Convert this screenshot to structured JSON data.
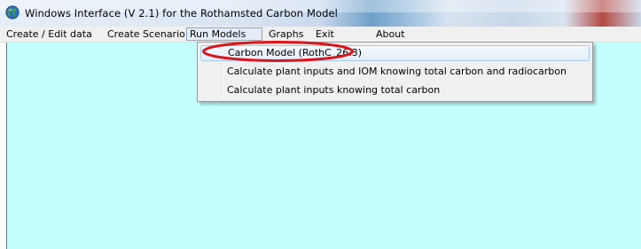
{
  "window": {
    "title": "Windows Interface (V 2.1)  for the Rothamsted Carbon Model",
    "icon": "globe-icon"
  },
  "menubar": {
    "items": [
      {
        "label": "Create / Edit data"
      },
      {
        "label": "Create Scenario"
      },
      {
        "label": "Run Models"
      },
      {
        "label": "Graphs"
      },
      {
        "label": "Exit"
      },
      {
        "label": "About"
      }
    ],
    "open_menu": "Run Models"
  },
  "dropdown": {
    "items": [
      {
        "label": "Carbon Model (RothC_26.3)",
        "highlighted": true
      },
      {
        "label": "Calculate plant inputs and IOM knowing total carbon and radiocarbon"
      },
      {
        "label": "Calculate plant inputs knowing total carbon"
      }
    ]
  },
  "annotation": {
    "shape": "ellipse",
    "color": "#d8161b",
    "target": "Carbon Model (RothC_26.3)"
  },
  "colors": {
    "client_background": "#c4ffff",
    "menubar_background": "#f0f0f0",
    "annotation_red": "#d8161b"
  }
}
